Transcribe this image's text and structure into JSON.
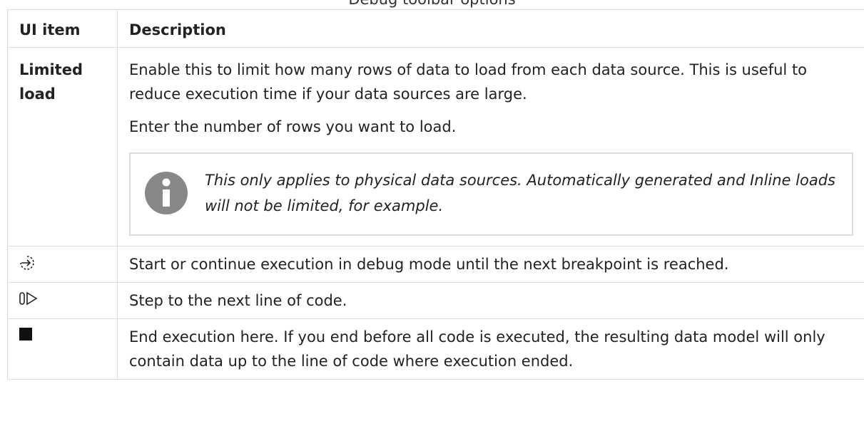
{
  "caption": "Debug toolbar options",
  "table": {
    "headers": [
      "UI item",
      "Description"
    ],
    "rows": [
      {
        "item": "Limited load",
        "paragraphs": [
          "Enable this to limit how many rows of data to load from each data source. This is useful to reduce execution time if your data sources are large.",
          "Enter the number of rows you want to load."
        ],
        "note": {
          "icon": "info-icon",
          "text": "This only applies to physical data sources. Automatically generated and Inline loads will not be limited, for example."
        }
      },
      {
        "item_icon": "debug-run-icon",
        "description": "Start or continue execution in debug mode until the next breakpoint is reached."
      },
      {
        "item_icon": "step-icon",
        "description": "Step to the next line of code."
      },
      {
        "item_icon": "stop-icon",
        "description": "End execution here. If you end before all code is executed, the resulting data model will only contain data up to the line of code where execution ended."
      }
    ]
  },
  "colors": {
    "border": "#dddddd",
    "note_border": "#dcdcdc",
    "info_icon": "#888888",
    "text": "#222222"
  }
}
